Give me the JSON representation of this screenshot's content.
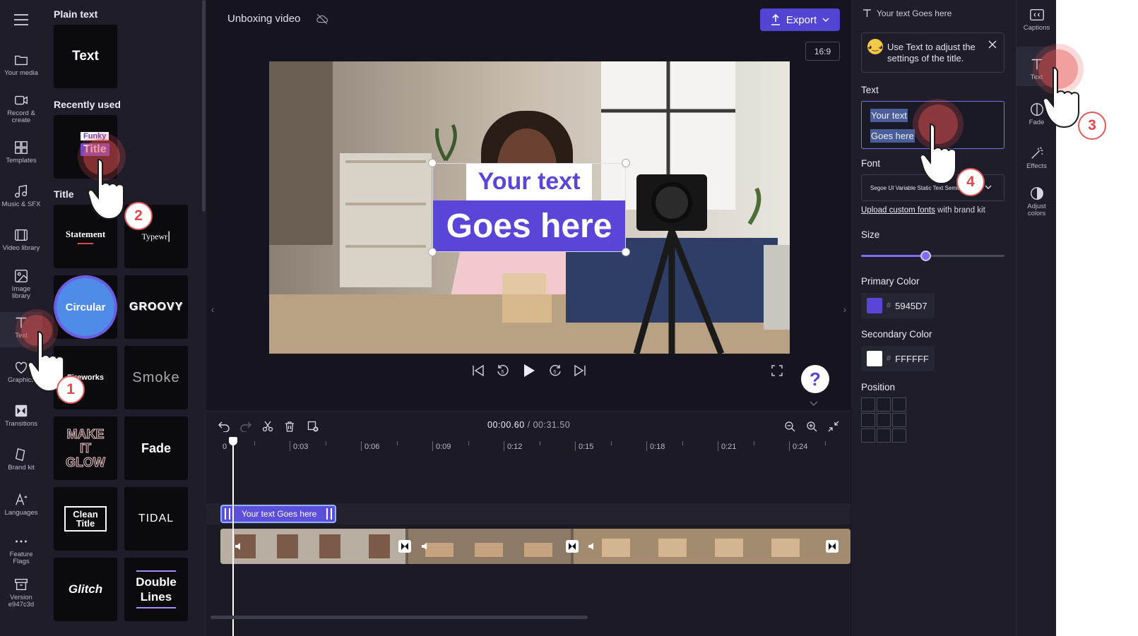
{
  "rail": {
    "items": [
      {
        "label": "Your media",
        "icon": "folder-icon"
      },
      {
        "label": "Record & create",
        "icon": "camera-icon"
      },
      {
        "label": "Templates",
        "icon": "templates-icon"
      },
      {
        "label": "Music & SFX",
        "icon": "music-icon"
      },
      {
        "label": "Video library",
        "icon": "film-icon"
      },
      {
        "label": "Image library",
        "icon": "image-icon"
      },
      {
        "label": "Text",
        "icon": "text-icon"
      },
      {
        "label": "Graphics",
        "icon": "shapes-icon"
      },
      {
        "label": "Transitions",
        "icon": "transition-icon"
      },
      {
        "label": "Brand kit",
        "icon": "brand-icon"
      },
      {
        "label": "Languages",
        "icon": "language-icon"
      },
      {
        "label": "Feature Flags",
        "icon": "more-icon"
      },
      {
        "label": "Version e947c3d",
        "icon": "archive-icon"
      }
    ]
  },
  "library": {
    "plain_heading": "Plain text",
    "plain_tile": "Text",
    "recent_heading": "Recently used",
    "recent_tile_line1": "Funky",
    "recent_tile_line2": "Title",
    "title_heading": "Title",
    "tiles": [
      {
        "label": "Statement"
      },
      {
        "label": "Typewr"
      },
      {
        "label": "Circular"
      },
      {
        "label": "GROOVY"
      },
      {
        "label": "Fireworks"
      },
      {
        "label": "Smoke"
      },
      {
        "label": "MAKE IT GLOW"
      },
      {
        "label": "Fade"
      },
      {
        "label": "Clean Title"
      },
      {
        "label": "TIDAL"
      },
      {
        "label": "Glitch"
      },
      {
        "label": "Double Lines"
      }
    ]
  },
  "header": {
    "project_title": "Unboxing video",
    "export_label": "Export",
    "aspect_ratio": "16:9"
  },
  "preview": {
    "text_line1": "Your text",
    "text_line2": "Goes here"
  },
  "timeline": {
    "current_time": "00:00.60",
    "total_time": "/ 00:31.50",
    "ruler": [
      "0",
      "0:03",
      "0:06",
      "0:09",
      "0:12",
      "0:15",
      "0:18",
      "0:21",
      "0:24"
    ],
    "text_clip_label": "Your text Goes here"
  },
  "props": {
    "header": "Your text Goes here",
    "tip": "Use Text to adjust the settings of the title.",
    "text_label": "Text",
    "text_value_line1": "Your text",
    "text_value_line2": "Goes here",
    "font_label": "Font",
    "font_value": "Segoe UI Variable Static Text Semibold",
    "upload_link": "Upload custom fonts",
    "upload_suffix": " with brand kit",
    "size_label": "Size",
    "size_fraction": 0.45,
    "primary_label": "Primary Color",
    "primary_hex": "5945D7",
    "primary_color": "#5945D7",
    "secondary_label": "Secondary Color",
    "secondary_hex": "FFFFFF",
    "secondary_color": "#FFFFFF",
    "position_label": "Position"
  },
  "right_rail": {
    "items": [
      {
        "label": "Captions",
        "icon": "captions-icon"
      },
      {
        "label": "Text",
        "icon": "text-icon"
      },
      {
        "label": "Fade",
        "icon": "fade-icon"
      },
      {
        "label": "Effects",
        "icon": "magic-wand-icon"
      },
      {
        "label": "Adjust colors",
        "icon": "contrast-icon"
      }
    ]
  },
  "steps": [
    "1",
    "2",
    "3",
    "4"
  ],
  "colors": {
    "accent": "#5245D4",
    "panel": "#1E1D29",
    "pointer": "#E05A5A"
  }
}
